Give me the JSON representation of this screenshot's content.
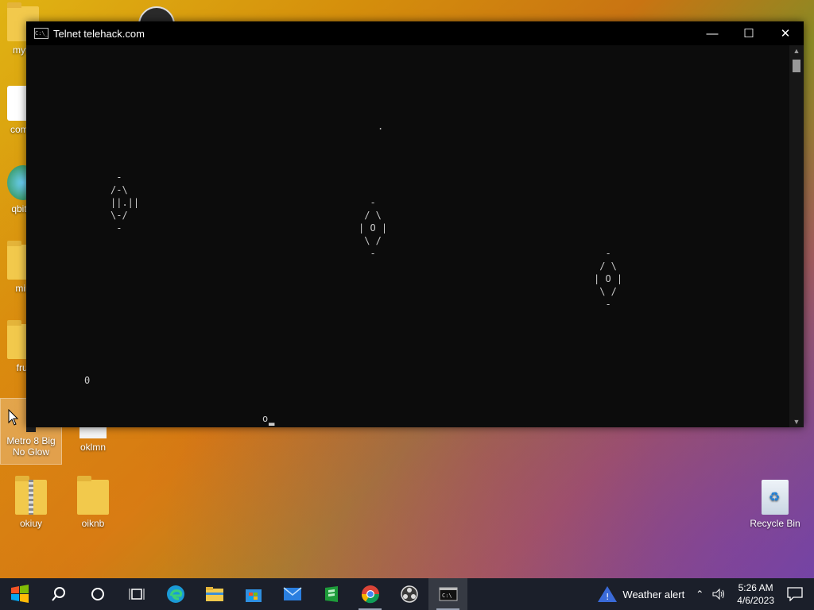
{
  "desktop_icons": {
    "mytask": "myta",
    "com": "com.c",
    "qbittorrent": "qbitto",
    "min": "min",
    "fruit": "frui",
    "metro_line1": "Metro 8 Big",
    "metro_line2": "No Glow",
    "oklmn": "oklmn",
    "okiuy": "okiuy",
    "oiknb": "oiknb",
    "recycle_bin": "Recycle Bin"
  },
  "window": {
    "title": "Telnet telehack.com",
    "app_icon_text": "C:\\_",
    "minimize": "—",
    "maximize": "☐",
    "close": "✕"
  },
  "console": {
    "star": ".",
    "asteroid_small": " -\n/-\\\n||.||\n\\-/\n -",
    "asteroid_mid": "  -\n / \\\n| O |\n \\ /\n  -",
    "asteroid_right": "  -\n / \\\n| O |\n \\ /\n  -",
    "ship": "0",
    "prompt_char": "o",
    "cursor": "▂"
  },
  "taskbar": {
    "weather_alert": "Weather alert",
    "time": "5:26 AM",
    "date": "4/6/2023"
  },
  "colors": {
    "taskbar_bg": "#1b1f2a",
    "console_bg": "#0c0c0c",
    "console_fg": "#cccccc"
  }
}
